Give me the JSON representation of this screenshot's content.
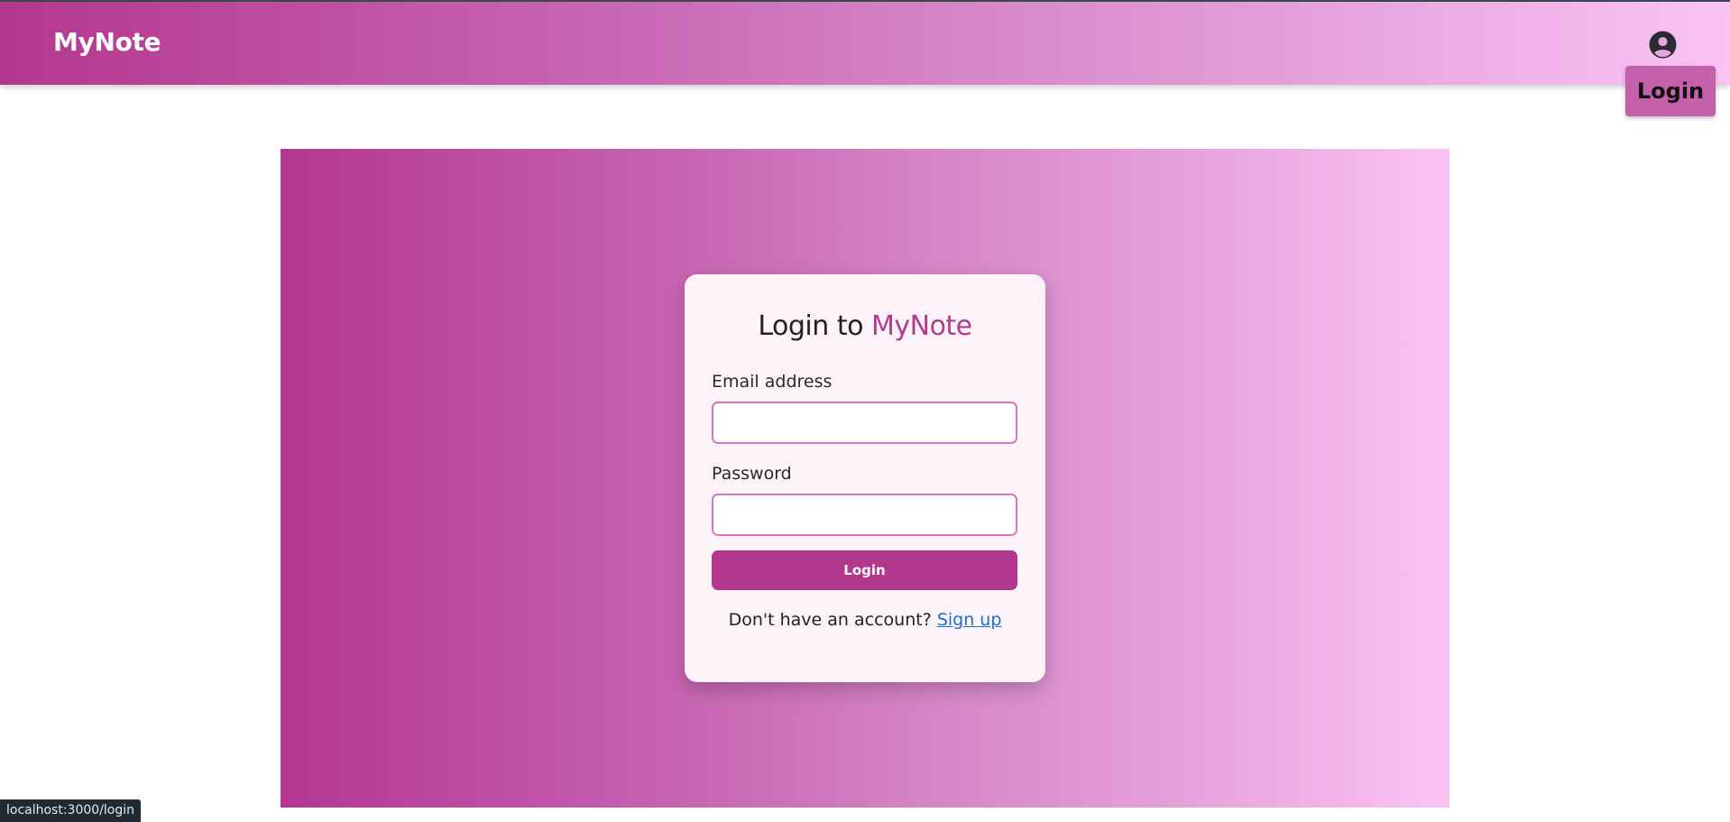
{
  "navbar": {
    "brand": "MyNote",
    "user_icon": "user-circle-icon",
    "login_label": "Login",
    "colors": {
      "gradient_start": "#b4378f",
      "gradient_end": "#fbc3f4",
      "login_button_bg": "#c560ad"
    }
  },
  "login_card": {
    "title_prefix": "Login to",
    "title_brand": "MyNote",
    "email_label": "Email address",
    "email_value": "",
    "password_label": "Password",
    "password_value": "",
    "submit_label": "Login",
    "signup_prompt": "Don't have an account?",
    "signup_link": "Sign up",
    "colors": {
      "accent": "#b23a8f",
      "input_border": "#d675c0",
      "button_bg": "#b3378e",
      "link": "#1a6fd6"
    }
  },
  "status_bar": {
    "url": "localhost:3000/login"
  }
}
